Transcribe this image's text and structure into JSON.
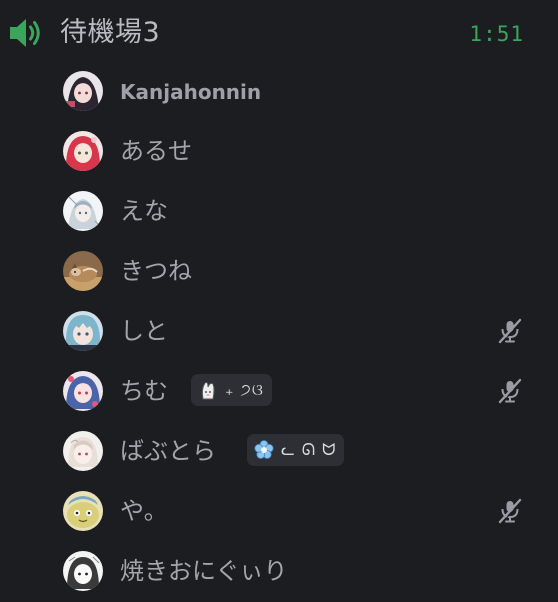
{
  "channel": {
    "name": "待機場3",
    "timer": "1:51",
    "icon": "speaker-icon",
    "accent": "#3ba55c"
  },
  "members": [
    {
      "name": "Kanjahonnin",
      "avatar": "avatar-1",
      "muted": false
    },
    {
      "name": "あるせ",
      "avatar": "avatar-2",
      "muted": false
    },
    {
      "name": "えな",
      "avatar": "avatar-3",
      "muted": false
    },
    {
      "name": "きつね",
      "avatar": "avatar-4",
      "muted": false
    },
    {
      "name": "しと",
      "avatar": "avatar-5",
      "muted": true
    },
    {
      "name": "ちむ",
      "avatar": "avatar-6",
      "muted": true,
      "badge": {
        "emoji": "bunny-emoji",
        "text": "₊ ੭ଓ"
      }
    },
    {
      "name": "ばぶとら",
      "avatar": "avatar-7",
      "muted": false,
      "badge": {
        "emoji": "flower-emoji",
        "text": "ᓚ ᘏ ᗢ"
      }
    },
    {
      "name": "や。",
      "avatar": "avatar-8",
      "muted": true
    },
    {
      "name": "焼きおにぐぃり",
      "avatar": "avatar-9",
      "muted": false
    }
  ],
  "colors": {
    "background": "#1c1d21",
    "text": "#a6a8b0",
    "muted_icon": "#9a9ca4",
    "badge_bg": "#2d2f35"
  }
}
